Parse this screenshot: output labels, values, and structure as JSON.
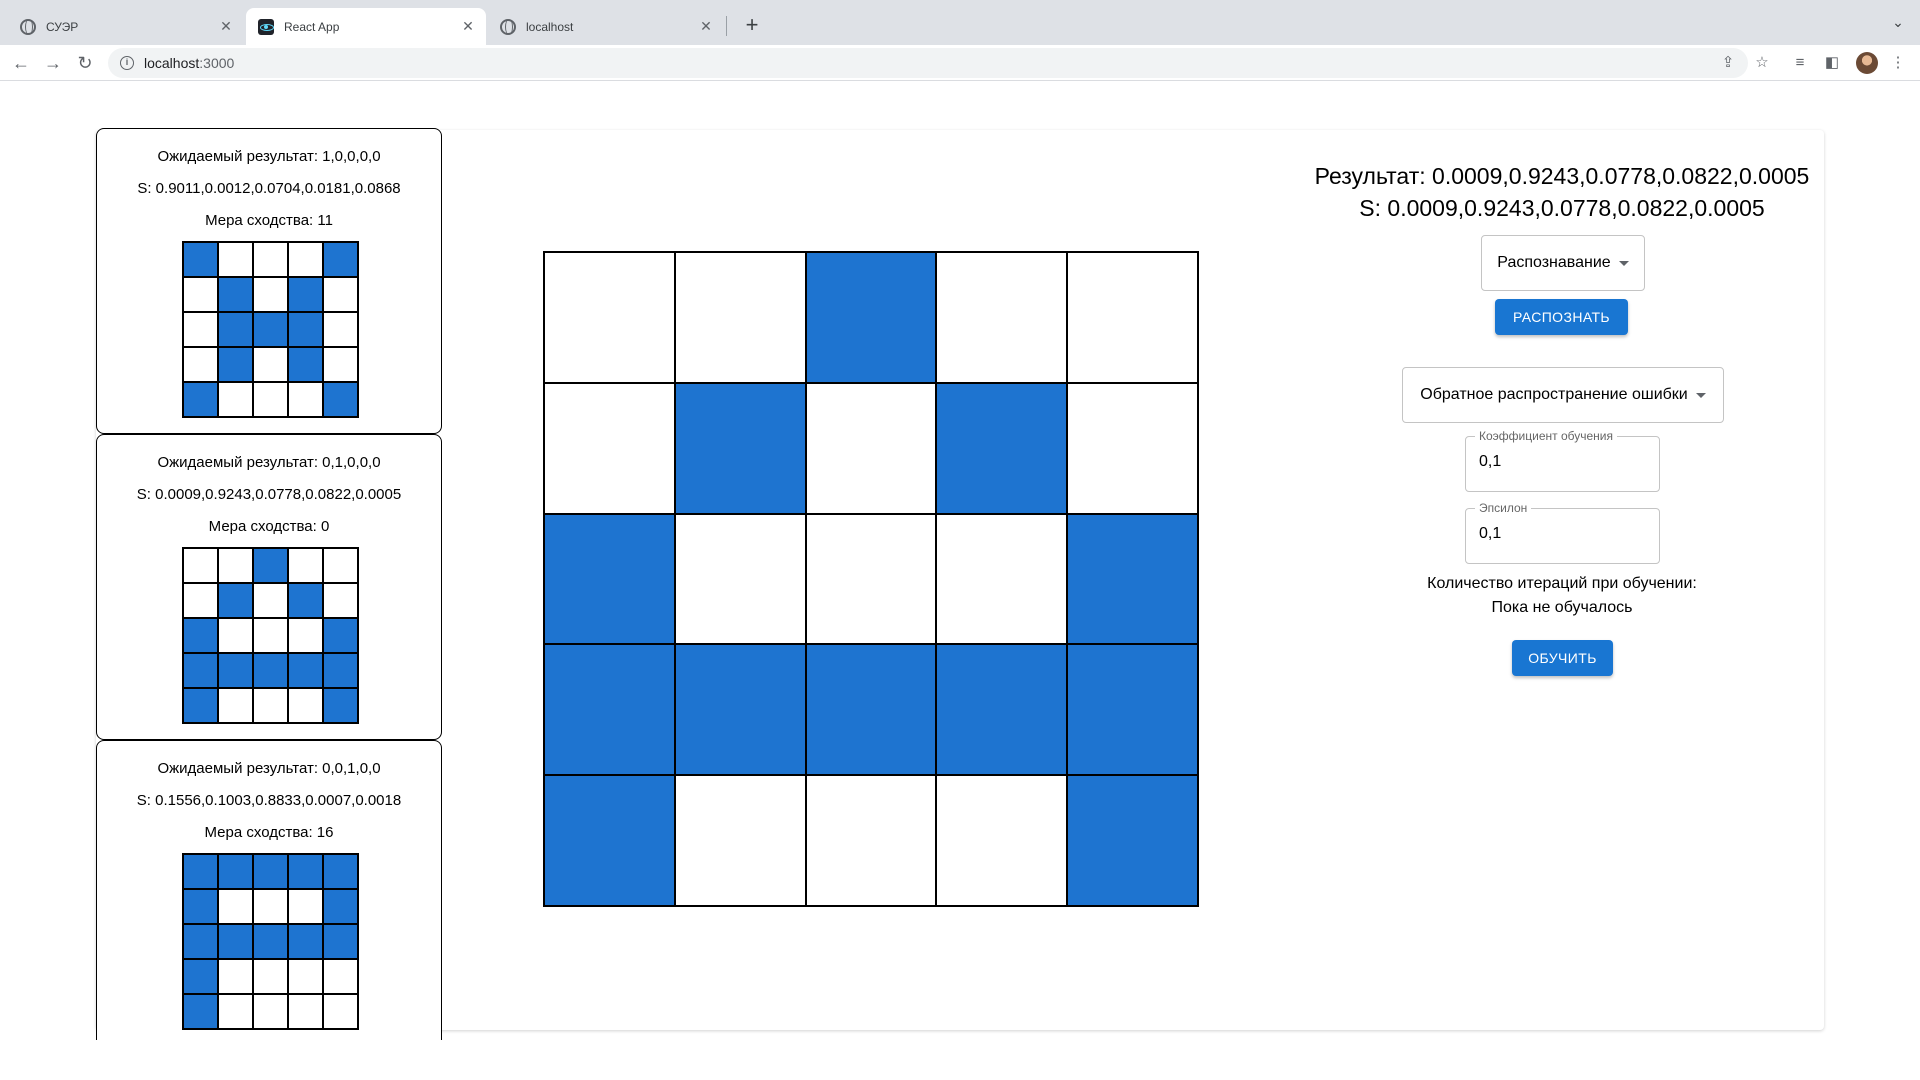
{
  "browser": {
    "tabs": [
      {
        "title": "СУЭР",
        "icon": "globe-icon"
      },
      {
        "title": "React App",
        "icon": "react-icon"
      },
      {
        "title": "localhost",
        "icon": "globe-icon"
      }
    ],
    "url_host": "localhost",
    "url_port": ":3000"
  },
  "samples": [
    {
      "expected": "Ожидаемый результат: 1,0,0,0,0",
      "s": "S: 0.9011,0.0012,0.0704,0.0181,0.0868",
      "similarity": "Мера сходства: 11",
      "pattern": [
        1,
        0,
        0,
        0,
        1,
        0,
        1,
        0,
        1,
        0,
        0,
        1,
        1,
        1,
        0,
        0,
        1,
        0,
        1,
        0,
        1,
        0,
        0,
        0,
        1
      ]
    },
    {
      "expected": "Ожидаемый результат: 0,1,0,0,0",
      "s": "S: 0.0009,0.9243,0.0778,0.0822,0.0005",
      "similarity": "Мера сходства: 0",
      "pattern": [
        0,
        0,
        1,
        0,
        0,
        0,
        1,
        0,
        1,
        0,
        1,
        0,
        0,
        0,
        1,
        1,
        1,
        1,
        1,
        1,
        1,
        0,
        0,
        0,
        1
      ]
    },
    {
      "expected": "Ожидаемый результат: 0,0,1,0,0",
      "s": "S: 0.1556,0.1003,0.8833,0.0007,0.0018",
      "similarity": "Мера сходства: 16",
      "pattern": [
        1,
        1,
        1,
        1,
        1,
        1,
        0,
        0,
        0,
        1,
        1,
        1,
        1,
        1,
        1,
        1,
        0,
        0,
        0,
        0,
        1,
        0,
        0,
        0,
        0
      ]
    }
  ],
  "main_grid": [
    0,
    0,
    1,
    0,
    0,
    0,
    1,
    0,
    1,
    0,
    1,
    0,
    0,
    0,
    1,
    1,
    1,
    1,
    1,
    1,
    1,
    0,
    0,
    0,
    1
  ],
  "right": {
    "result_line": "Результат: 0.0009,0.9243,0.0778,0.0822,0.0005",
    "s_line": "S: 0.0009,0.9243,0.0778,0.0822,0.0005",
    "mode_select": "Распознавание",
    "recognize_button": "РАСПОЗНАТЬ",
    "algorithm_select": "Обратное распространение ошибки",
    "learning_rate": {
      "label": "Коэффициент обучения",
      "value": "0,1"
    },
    "epsilon": {
      "label": "Эпсилон",
      "value": "0,1"
    },
    "iterations_label": "Количество итераций при обучении:",
    "iterations_value": "Пока не обучалось",
    "train_button": "ОБУЧИТЬ"
  },
  "colors": {
    "filled": "#1e74d0",
    "accent": "#1976d2"
  }
}
